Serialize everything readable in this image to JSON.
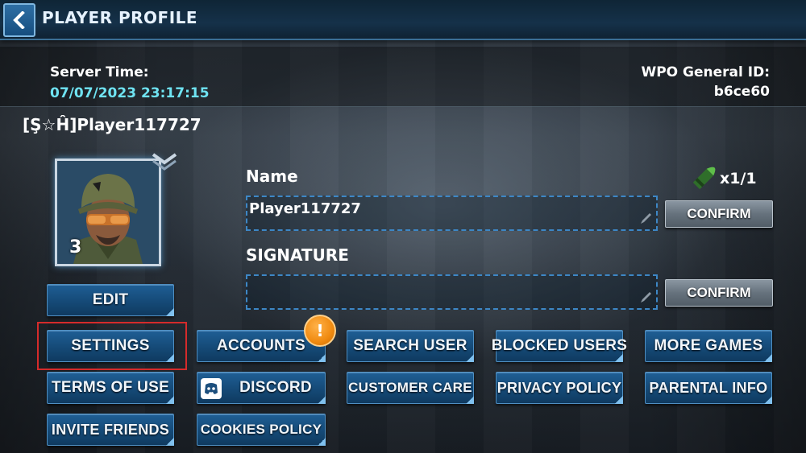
{
  "header": {
    "title": "PLAYER PROFILE",
    "back_icon": "back-arrow-icon"
  },
  "info": {
    "server_time_label": "Server Time:",
    "server_time_value": "07/07/2023 23:17:15",
    "general_id_label": "WPO General ID:",
    "general_id_value": "b6ce60"
  },
  "player": {
    "tag": "[Ş☆Ĥ]Player117727",
    "level": "3",
    "edit_label": "EDIT"
  },
  "name_section": {
    "label": "Name",
    "value": "Player117727",
    "confirm_label": "CONFIRM",
    "rename_count": "x1/1"
  },
  "signature_section": {
    "label": "SIGNATURE",
    "value": "",
    "confirm_label": "CONFIRM"
  },
  "menu": {
    "settings": "SETTINGS",
    "accounts": "ACCOUNTS",
    "accounts_alert": "!",
    "search_user": "SEARCH USER",
    "blocked_users": "BLOCKED USERS",
    "more_games": "MORE GAMES",
    "terms_of_use": "TERMS OF USE",
    "discord": "DISCORD",
    "customer_care": "CUSTOMER CARE",
    "privacy_policy": "PRIVACY POLICY",
    "parental_info": "PARENTAL INFO",
    "invite_friends": "INVITE FRIENDS",
    "cookies_policy": "COOKIES POLICY"
  },
  "colors": {
    "accent_cyan": "#6fe3f2",
    "button_blue": "#154a77",
    "alert_orange": "#f08a10",
    "highlight_red": "#d52b2b"
  }
}
